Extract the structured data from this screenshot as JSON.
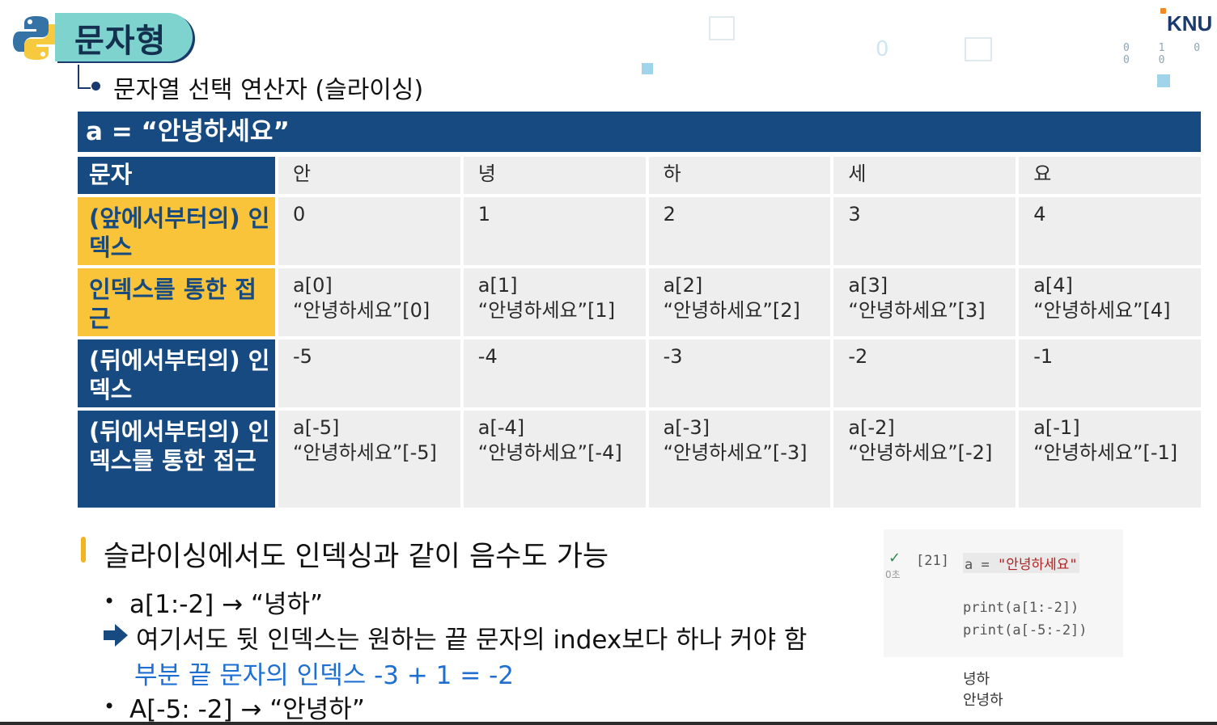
{
  "header": {
    "title": "문자형",
    "subtitle": "문자열 선택 연산자 (슬라이싱)",
    "logo_text": "KNU",
    "binary_text": "0 1 0 0 0",
    "faint_zero": "0"
  },
  "colors": {
    "navy": "#174a80",
    "gold": "#f9c43a",
    "teal": "#7fd3cf",
    "cell_bg": "#eeeeee",
    "blue_text": "#1f6fd2"
  },
  "table": {
    "header": "a = “안녕하세요”",
    "rows": [
      {
        "label": "문자",
        "style": "blue",
        "cells": [
          [
            "안"
          ],
          [
            "녕"
          ],
          [
            "하"
          ],
          [
            "세"
          ],
          [
            "요"
          ]
        ]
      },
      {
        "label": "(앞에서부터의) 인덱스",
        "style": "gold",
        "cells": [
          [
            "0"
          ],
          [
            "1"
          ],
          [
            "2"
          ],
          [
            "3"
          ],
          [
            "4"
          ]
        ]
      },
      {
        "label": "인덱스를 통한 접근",
        "style": "gold",
        "cells": [
          [
            "a[0]",
            "“안녕하세요”[0]"
          ],
          [
            "a[1]",
            "“안녕하세요”[1]"
          ],
          [
            "a[2]",
            "“안녕하세요”[2]"
          ],
          [
            "a[3]",
            "“안녕하세요”[3]"
          ],
          [
            "a[4]",
            "“안녕하세요”[4]"
          ]
        ]
      },
      {
        "label": "(뒤에서부터의) 인덱스",
        "style": "blue",
        "cells": [
          [
            "-5"
          ],
          [
            "-4"
          ],
          [
            "-3"
          ],
          [
            "-2"
          ],
          [
            "-1"
          ]
        ]
      },
      {
        "label": "(뒤에서부터의) 인덱스를 통한 접근",
        "style": "blue",
        "cells": [
          [
            "a[-5]",
            "“안녕하세요”[-5]"
          ],
          [
            "a[-4]",
            "“안녕하세요”[-4]"
          ],
          [
            "a[-3]",
            "“안녕하세요”[-3]"
          ],
          [
            "a[-2]",
            "“안녕하세요”[-2]"
          ],
          [
            "a[-1]",
            "“안녕하세요”[-1]"
          ]
        ]
      }
    ]
  },
  "notes": {
    "heading": "슬라이싱에서도 인덱싱과 같이 음수도 가능",
    "item1": "a[1:-2] → “녕하”",
    "arrow_text": "여기서도 뒷 인덱스는 원하는 끝 문자의 index보다 하나 커야 함",
    "blue_line": "부분 끝 문자의 인덱스 -3 + 1 = -2",
    "item2": "A[-5: -2] → “안녕하”"
  },
  "code": {
    "cell_number": "[21]",
    "exec_time": "0초",
    "line1_var": "a = ",
    "line1_str": "\"안녕하세요\"",
    "line2": "print(a[1:-2])",
    "line3": "print(a[-5:-2])",
    "output1": "녕하",
    "output2": "안녕하"
  }
}
